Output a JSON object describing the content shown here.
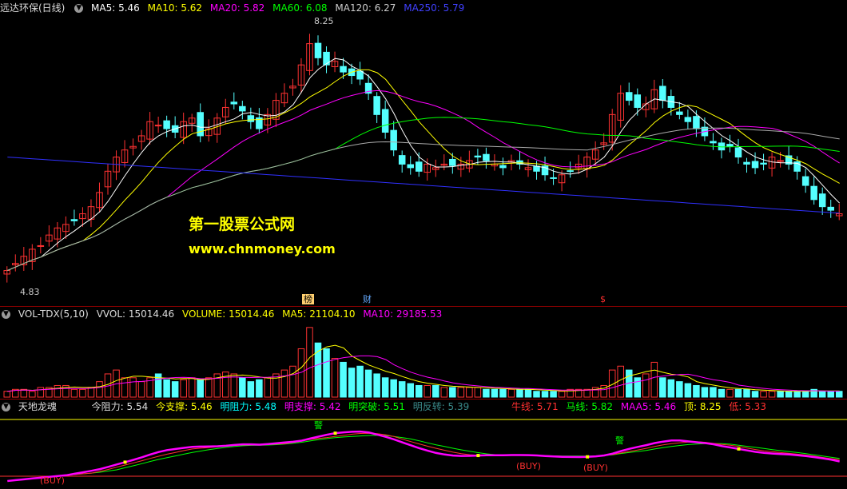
{
  "main_header": {
    "title": "远达环保(日线)",
    "ma5": "MA5: 5.46",
    "ma10": "MA10: 5.62",
    "ma20": "MA20: 5.82",
    "ma60": "MA60: 6.08",
    "ma120": "MA120: 6.27",
    "ma250": "MA250: 5.79"
  },
  "main_labels": {
    "high": "8.25",
    "low": "4.83",
    "tag_bang": "榜",
    "tag_cai": "财",
    "tag_dollar": "$"
  },
  "watermark": {
    "line1": "第一股票公式网",
    "line2": "www.chnmoney.com"
  },
  "vol_header": {
    "title": "VOL-TDX(5,10)",
    "vvol": "VVOL: 15014.46",
    "volume": "VOLUME: 15014.46",
    "ma5": "MA5: 21104.10",
    "ma10": "MA10: 29185.53"
  },
  "ind_header": {
    "title": "天地龙魂",
    "jin_zuli": "今阻力: 5.54",
    "jin_zhicheng": "今支撑: 5.46",
    "ming_zuli": "明阻力: 5.48",
    "ming_zhicheng": "明支撑: 5.42",
    "ming_tupo": "明突破: 5.51",
    "ming_fanzhuan": "明反转: 5.39",
    "niuxian": "牛线: 5.71",
    "maxian": "马线: 5.82",
    "maa5": "MAA5: 5.46",
    "ding": "顶: 8.25",
    "di": "低: 5.33"
  },
  "ind_labels": {
    "warn": "警",
    "buy": "(BUY)"
  },
  "colors": {
    "up": "#ff3232",
    "down": "#54ffff",
    "ma5": "#ffffff",
    "ma10": "#ffff00",
    "ma20": "#ff00ff",
    "ma60": "#00ff00",
    "ma120": "#aaaaaa",
    "ma250": "#3030ff"
  },
  "chart_data": {
    "type": "candlestick",
    "close": [
      5.0,
      5.1,
      5.2,
      5.3,
      5.35,
      5.5,
      5.6,
      5.65,
      5.7,
      5.8,
      5.9,
      6.1,
      6.4,
      6.6,
      6.7,
      6.75,
      6.9,
      7.1,
      7.05,
      7.0,
      6.95,
      7.1,
      7.15,
      6.9,
      7.0,
      7.15,
      7.3,
      7.35,
      7.25,
      7.1,
      7.0,
      7.2,
      7.4,
      7.5,
      7.6,
      7.9,
      8.2,
      8.0,
      7.9,
      7.95,
      7.8,
      7.75,
      7.7,
      7.5,
      7.2,
      6.95,
      6.7,
      6.5,
      6.45,
      6.4,
      6.5,
      6.45,
      6.5,
      6.48,
      6.5,
      6.55,
      6.6,
      6.55,
      6.5,
      6.45,
      6.55,
      6.5,
      6.45,
      6.4,
      6.35,
      6.3,
      6.35,
      6.4,
      6.5,
      6.6,
      6.7,
      6.8,
      7.2,
      7.5,
      7.4,
      7.3,
      7.35,
      7.55,
      7.4,
      7.3,
      7.2,
      7.1,
      7.0,
      6.9,
      6.8,
      6.7,
      6.75,
      6.6,
      6.5,
      6.45,
      6.5,
      6.6,
      6.55,
      6.5,
      6.4,
      6.2,
      6.0,
      5.9,
      5.85,
      5.8
    ],
    "volume": [
      3,
      4,
      4,
      3,
      5,
      5,
      6,
      6,
      4,
      4,
      5,
      8,
      12,
      14,
      10,
      10,
      8,
      10,
      12,
      9,
      8,
      9,
      10,
      9,
      10,
      12,
      13,
      12,
      10,
      8,
      9,
      10,
      12,
      14,
      16,
      25,
      36,
      28,
      25,
      20,
      18,
      15,
      16,
      14,
      12,
      10,
      9,
      8,
      7,
      6,
      6,
      6,
      5,
      5,
      5,
      5,
      5,
      4,
      4,
      4,
      4,
      4,
      4,
      3,
      3,
      3,
      3,
      4,
      4,
      4,
      5,
      6,
      14,
      16,
      14,
      10,
      12,
      18,
      10,
      9,
      8,
      7,
      6,
      5,
      5,
      4,
      4,
      4,
      4,
      3,
      3,
      3,
      3,
      3,
      3,
      3,
      4,
      3,
      3,
      3
    ]
  }
}
